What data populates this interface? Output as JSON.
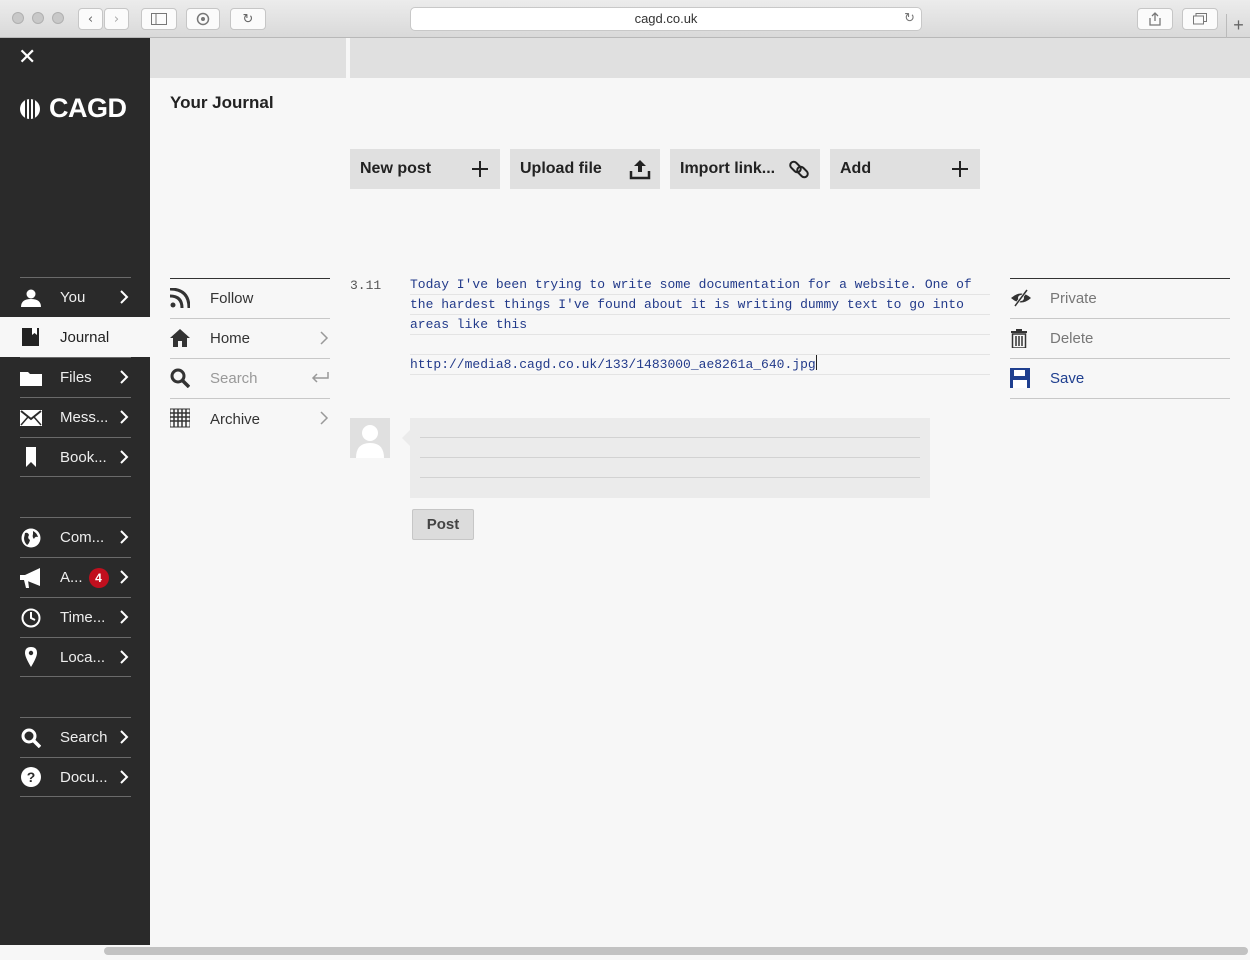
{
  "browser": {
    "url": "cagd.co.uk"
  },
  "sidebar": {
    "logo": "CAGD",
    "group1": [
      {
        "label": "You",
        "icon": "person-icon"
      },
      {
        "label": "Journal",
        "icon": "journal-icon",
        "active": true
      },
      {
        "label": "Files",
        "icon": "folder-icon"
      },
      {
        "label": "Mess...",
        "icon": "envelope-icon"
      },
      {
        "label": "Book...",
        "icon": "bookmark-icon"
      }
    ],
    "group2": [
      {
        "label": "Com...",
        "icon": "globe-icon"
      },
      {
        "label": "A...",
        "icon": "megaphone-icon",
        "badge": "4"
      },
      {
        "label": "Time...",
        "icon": "clock-icon"
      },
      {
        "label": "Loca...",
        "icon": "pin-icon"
      }
    ],
    "group3": [
      {
        "label": "Search",
        "icon": "search-icon"
      },
      {
        "label": "Docu...",
        "icon": "help-icon"
      }
    ]
  },
  "page": {
    "title": "Your Journal"
  },
  "actions": {
    "new_post": "New post",
    "upload_file": "Upload file",
    "import_link": "Import link...",
    "add": "Add"
  },
  "subnav": {
    "follow": "Follow",
    "home": "Home",
    "search_placeholder": "Search",
    "archive": "Archive"
  },
  "post": {
    "date": "3.11",
    "lines": [
      "Today I've been trying to write some documentation for a website. One of",
      "the hardest things I've found about it is writing dummy text to go into",
      "areas like this",
      "",
      "http://media8.cagd.co.uk/133/1483000_ae8261a_640.jpg"
    ]
  },
  "post_actions": {
    "private": "Private",
    "delete": "Delete",
    "save": "Save"
  },
  "comment": {
    "post_button": "Post"
  },
  "colors": {
    "sidebar_bg": "#2a2a2a",
    "accent_blue": "#1f3f8f",
    "badge_red": "#c10f1e"
  }
}
